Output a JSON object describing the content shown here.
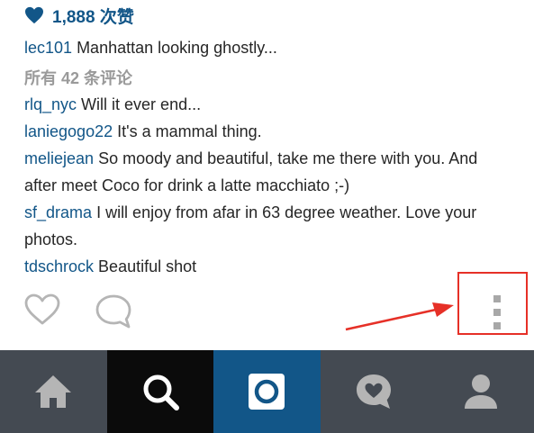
{
  "post": {
    "likes": "1,888 次赞",
    "caption": {
      "user": "lec101",
      "text": "Manhattan looking ghostly..."
    },
    "all_comments_label": "所有 42 条评论",
    "comments": [
      {
        "user": "rlq_nyc",
        "text": "Will it ever end..."
      },
      {
        "user": "laniegogo22",
        "text": "It's a mammal thing."
      },
      {
        "user": "meliejean",
        "text": "So moody and beautiful, take me there with you. And after meet Coco for drink a latte macchiato ;-)"
      },
      {
        "user": "sf_drama",
        "text": "I will enjoy from afar in 63 degree weather. Love your photos."
      },
      {
        "user": "tdschrock",
        "text": "Beautiful shot"
      }
    ]
  },
  "actions": [
    {
      "id": "like",
      "icon": "heart-outline-icon"
    },
    {
      "id": "comment",
      "icon": "speech-bubble-icon"
    },
    {
      "id": "more",
      "icon": "more-vertical-icon"
    }
  ],
  "tabs": [
    {
      "id": "home",
      "icon": "home-icon",
      "active": false
    },
    {
      "id": "search",
      "icon": "search-icon",
      "active": true
    },
    {
      "id": "camera",
      "icon": "camera-icon",
      "active": false
    },
    {
      "id": "activity",
      "icon": "heart-bubble-icon",
      "active": false
    },
    {
      "id": "profile",
      "icon": "profile-icon",
      "active": false
    }
  ],
  "colors": {
    "username": "#125688",
    "text": "#262626",
    "muted": "#9a9a9a",
    "icon": "#b5b5b5",
    "tabbar": "#444a52",
    "tab_search": "#0b0b0b",
    "tab_camera": "#125688",
    "annotation": "#e63027"
  }
}
